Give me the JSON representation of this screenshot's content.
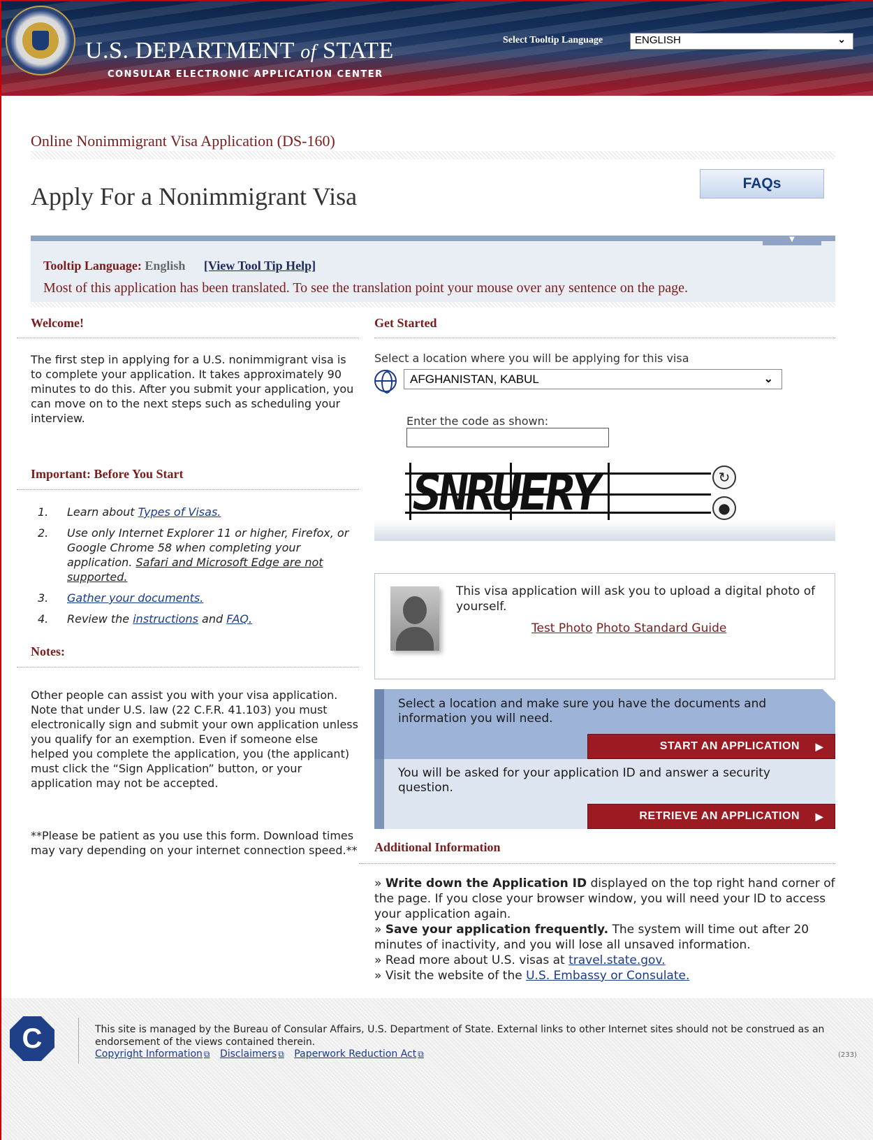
{
  "header": {
    "dept_title_main": "U.S. D",
    "dept_title": [
      "U.S. DEPARTMENT",
      "of",
      "STATE"
    ],
    "dept_subtitle": "CONSULAR ELECTRONIC APPLICATION CENTER",
    "tooltip_language_label": "Select Tooltip Language",
    "tooltip_language_value": "ENGLISH"
  },
  "page": {
    "app_title": "Online Nonimmigrant Visa Application (DS-160)",
    "heading": "Apply For a Nonimmigrant Visa",
    "faq_button": "FAQs"
  },
  "tooltip_bar": {
    "label": "Tooltip Language:",
    "value": "English",
    "help_link": "[View Tool Tip Help]",
    "message": "Most of this application has been translated. To see the translation point your mouse over any sentence on the page."
  },
  "left": {
    "welcome_heading": "Welcome!",
    "welcome_text": "The first step in applying for a U.S. nonimmigrant visa is to complete your application. It takes approximately 90 minutes to do this. After you submit your application, you can move on to the next steps such as scheduling your interview.",
    "before_heading": "Important: Before You Start",
    "before_items": [
      {
        "num": "1.",
        "pre": "Learn about ",
        "link": "Types of Visas.",
        "post": "",
        "link2": "",
        "post2": ""
      },
      {
        "num": "2.",
        "pre": "Use only Internet Explorer 11 or higher, Firefox, or Google Chrome 58 when completing your application. ",
        "link": "Safari and Microsoft Edge are not supported.",
        "post": "",
        "link2": "",
        "post2": ""
      },
      {
        "num": "3.",
        "pre": "",
        "link": "Gather your documents.",
        "post": "",
        "link2": "",
        "post2": ""
      },
      {
        "num": "4.",
        "pre": "Review the ",
        "link": "instructions",
        "post": " and ",
        "link2": "FAQ.",
        "post2": ""
      }
    ],
    "notes_heading": "Notes:",
    "notes_text": "Other people can assist you with your visa application. Note that under U.S. law (22 C.F.R. 41.103) you must electronically sign and submit your own application unless you qualify for an exemption. Even if someone else helped you complete the application, you (the applicant) must click the “Sign Application” button, or your application may not be accepted.",
    "patience_text": "**Please be patient as you use this form. Download times may vary depending on your internet connection speed.**"
  },
  "right": {
    "get_started_heading": "Get Started",
    "location_label": "Select a location where you will be applying for this visa",
    "location_value": "AFGHANISTAN, KABUL",
    "code_label": "Enter the code as shown:",
    "code_value": "",
    "captcha_text": "SNRUERY",
    "photo_text": "This visa application will ask you to upload a digital photo of yourself.",
    "photo_link1": "Test Photo",
    "photo_link2": "Photo Standard Guide",
    "start_text": "Select a location and make sure you have the documents and information you will need.",
    "start_button": "START AN APPLICATION",
    "retrieve_text": "You will be asked for your application ID and answer a security question.",
    "retrieve_button": "RETRIEVE AN APPLICATION",
    "additional_heading": "Additional Information",
    "additional": {
      "p1_bold": "Write down the Application ID",
      "p1_rest": " displayed on the top right hand corner of the page. If you close your browser window, you will need your ID to access your application again.",
      "p2_bold": "Save your application frequently.",
      "p2_rest": " The system will time out after 20 minutes of inactivity, and you will lose all unsaved information.",
      "p3_pre": "Read more about U.S. visas at ",
      "p3_link": "travel.state.gov.",
      "p4_pre": "Visit the website of the ",
      "p4_link": "U.S. Embassy or Consulate."
    }
  },
  "footer": {
    "text": "This site is managed by the Bureau of Consular Affairs, U.S. Department of State. External links to other Internet sites should not be construed as an endorsement of the views contained therein.",
    "links": [
      "Copyright Information",
      "Disclaimers",
      "Paperwork Reduction Act"
    ],
    "code": "(233)"
  },
  "icons": {
    "seal": "department-of-state-seal",
    "globe": "globe-icon",
    "refresh": "refresh-icon",
    "audio": "audio-icon",
    "external": "external-link-icon",
    "footer_logo": "consular-affairs-logo"
  },
  "colors": {
    "accent_red": "#9c1b22",
    "heading_maroon": "#7a1c1c",
    "link_blue": "#1a3a8a",
    "panel_blue": "#9db3d7"
  }
}
